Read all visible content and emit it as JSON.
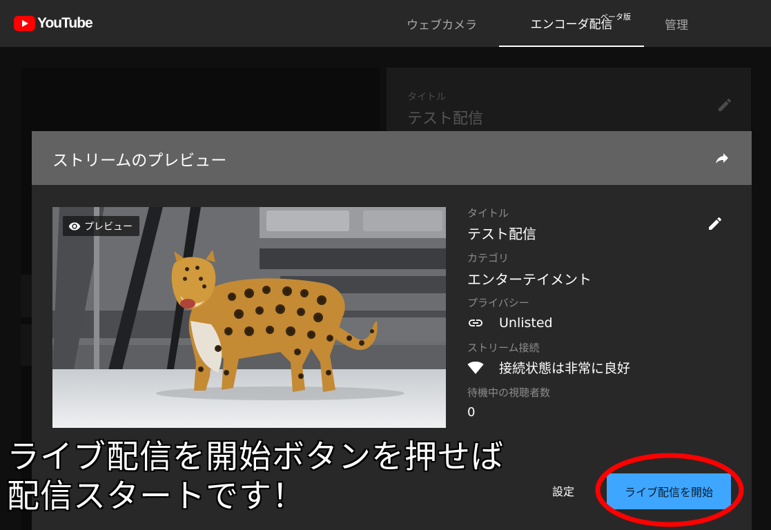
{
  "app": {
    "logo_text": "YouTube"
  },
  "nav": {
    "tabs": [
      {
        "label": "ウェブカメラ",
        "active": false
      },
      {
        "label": "エンコーダ配信",
        "active": true
      },
      {
        "label": "管理",
        "active": false
      }
    ],
    "beta_badge": "ベータ版"
  },
  "background_card": {
    "title_label": "タイトル",
    "title_value": "テスト配信"
  },
  "modal": {
    "title": "ストリームのプレビュー",
    "preview_badge": "プレビュー",
    "fields": {
      "title_label": "タイトル",
      "title_value": "テスト配信",
      "category_label": "カテゴリ",
      "category_value": "エンターテイメント",
      "privacy_label": "プライバシー",
      "privacy_value": "Unlisted",
      "connection_label": "ストリーム接続",
      "connection_value": "接続状態は非常に良好",
      "viewers_label": "待機中の視聴者数",
      "viewers_value": "0"
    },
    "settings_label": "設定",
    "start_label": "ライブ配信を開始"
  },
  "annotation": {
    "line1": "ライブ配信を開始ボタンを押せば",
    "line2": "配信スタートです！"
  },
  "colors": {
    "topbar": "#282828",
    "modal_bg": "#282828",
    "modal_header": "#626262",
    "accent_blue": "#3ea6ff",
    "logo_red": "#ff0000",
    "annotation_red": "#ff0000"
  },
  "icons": [
    "youtube-logo-icon",
    "share-arrow-icon",
    "pencil-icon",
    "eye-icon",
    "link-icon",
    "wifi-icon"
  ]
}
